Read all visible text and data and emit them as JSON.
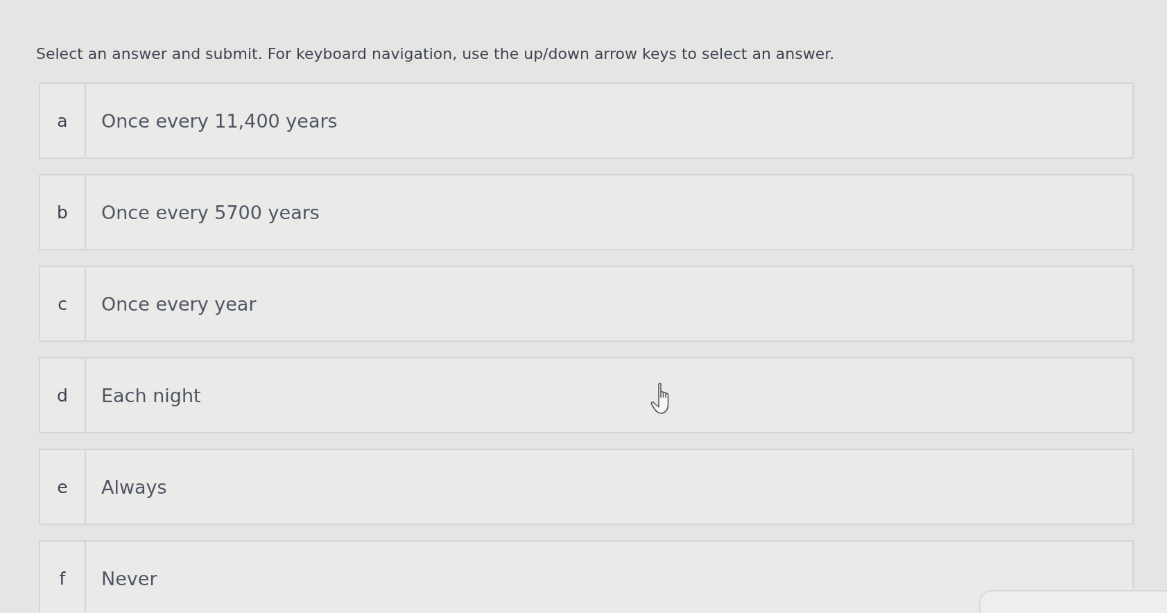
{
  "instructions": "Select an answer and submit. For keyboard navigation, use the up/down arrow keys to select an answer.",
  "options": [
    {
      "letter": "a",
      "text": "Once every 11,400 years",
      "selected": false
    },
    {
      "letter": "b",
      "text": "Once every 5700 years",
      "selected": false
    },
    {
      "letter": "c",
      "text": "Once every year",
      "selected": false
    },
    {
      "letter": "d",
      "text": "Each night",
      "selected": false
    },
    {
      "letter": "e",
      "text": "Always",
      "selected": false
    },
    {
      "letter": "f",
      "text": "Never",
      "selected": false
    }
  ]
}
